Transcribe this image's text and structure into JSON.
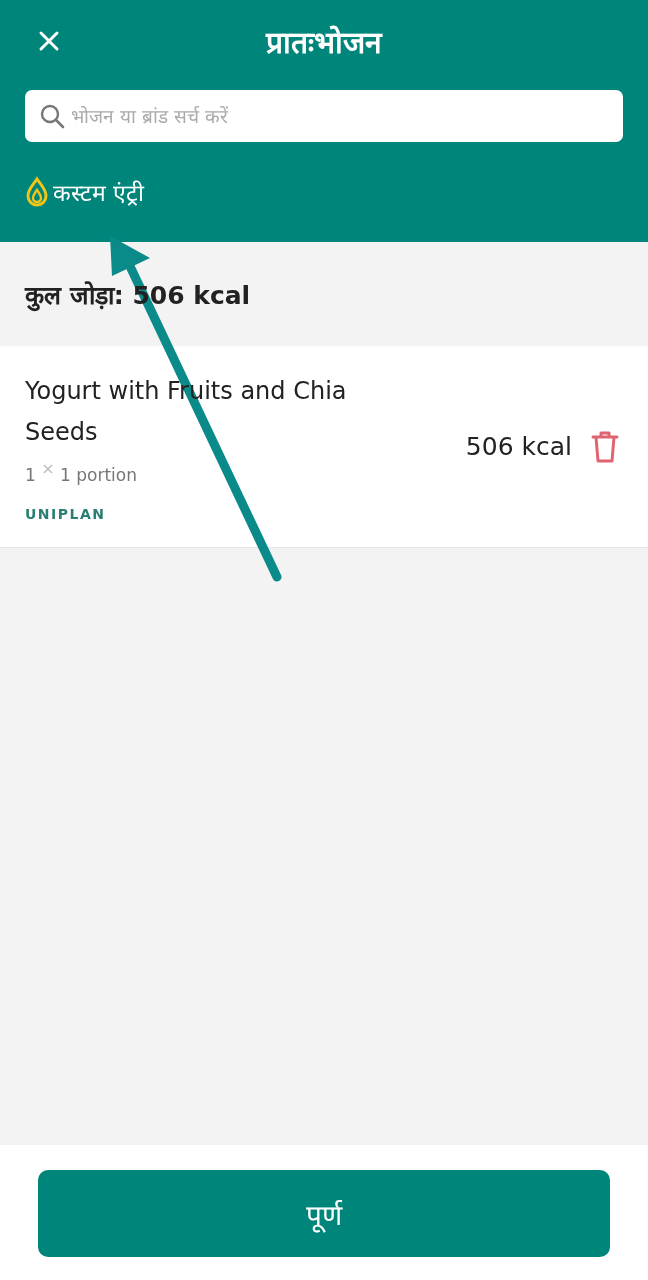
{
  "header": {
    "title": "प्रातःभोजन",
    "search": {
      "placeholder": "भोजन या ब्रांड सर्च करें"
    },
    "custom_entry": "कस्टम एंट्री"
  },
  "total": "कुल जोड़ा: 506 kcal",
  "items": [
    {
      "name": "Yogurt with Fruits and Chia Seeds",
      "count": "1",
      "times": "×",
      "portion": "1 portion",
      "source": "UNIPLAN",
      "energy": "506 kcal"
    }
  ],
  "annotation": {
    "kind": "arrow"
  },
  "done_button": "पूर्ण"
}
